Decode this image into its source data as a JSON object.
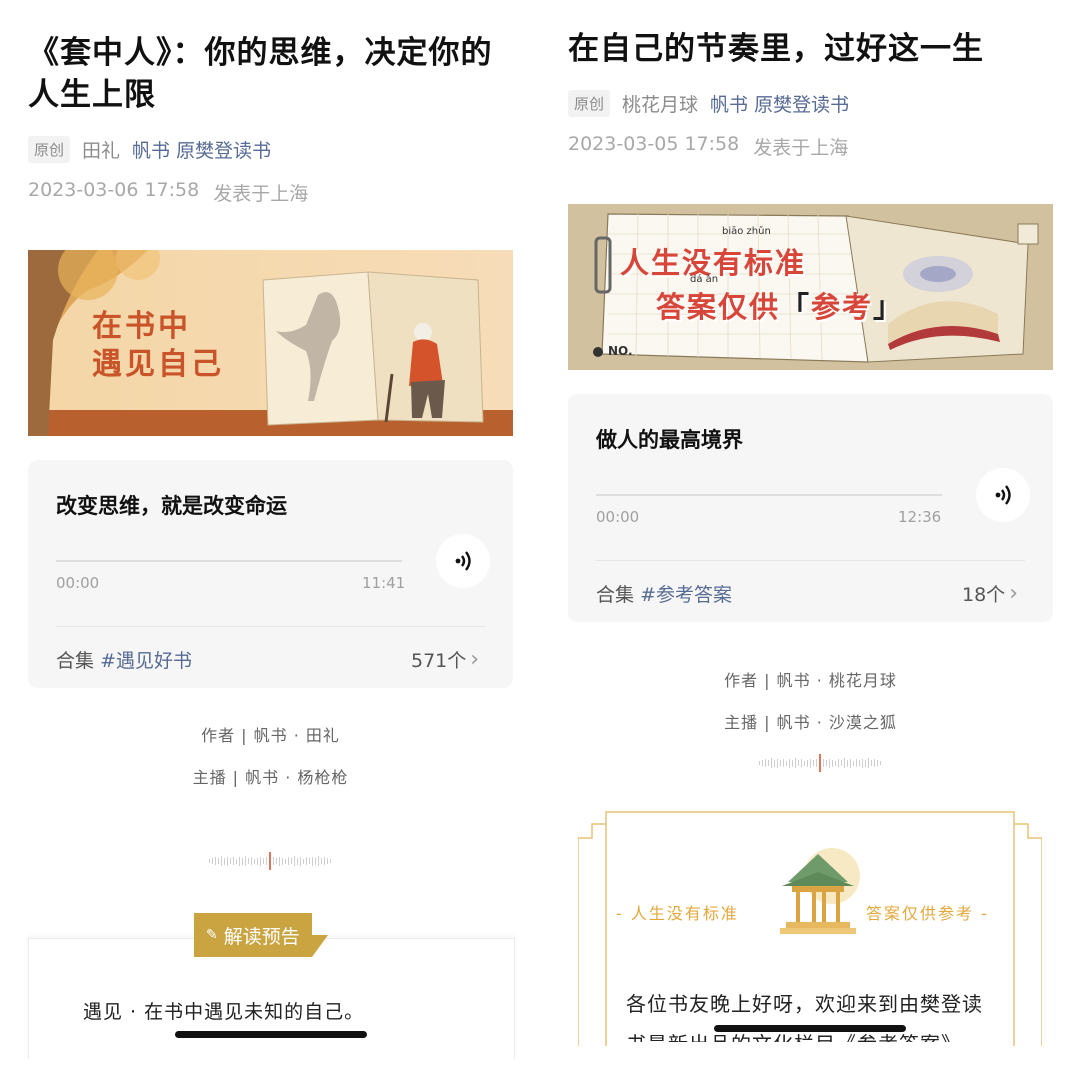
{
  "left": {
    "title": "《套中人》：你的思维，决定你的人生上限",
    "badge": "原创",
    "author": "田礼",
    "account": "帆书 原樊登读书",
    "date": "2023-03-06 17:58",
    "location": "发表于上海",
    "banner_text_line1": "在书中",
    "banner_text_line2": "遇见自己",
    "audio": {
      "title": "改变思维，就是改变命运",
      "current": "00:00",
      "duration": "11:41",
      "progress": 0
    },
    "collection": {
      "label": "合集",
      "tag": "#遇见好书",
      "count": "571个"
    },
    "credit_author": "作者 | 帆书 · 田礼",
    "credit_host": "主播 | 帆书 · 杨枪枪",
    "preview_tag": "解读预告",
    "body_text": "遇见 · 在书中遇见未知的自己。"
  },
  "right": {
    "title": "在自己的节奏里，过好这一生",
    "badge": "原创",
    "author": "桃花月球",
    "account": "帆书 原樊登读书",
    "date": "2023-03-05 17:58",
    "location": "发表于上海",
    "banner_line1": "人生没有标准",
    "banner_line2_a": "答案仅供",
    "banner_line2_b": "参考",
    "pinyin_biaozhun": "biāo zhǔn",
    "pinyin_daan": "dá àn",
    "banner_no": "NO.",
    "audio": {
      "title": "做人的最高境界",
      "current": "00:00",
      "duration": "12:36",
      "progress": 0
    },
    "collection": {
      "label": "合集",
      "tag": "#参考答案",
      "count": "18个"
    },
    "credit_author": "作者 | 帆书 · 桃花月球",
    "credit_host": "主播 | 帆书 · 沙漠之狐",
    "frame_left": "- 人生没有标准",
    "frame_right": "答案仅供参考 -",
    "body_text_1": "各位书友晚上好呀，欢迎来到由樊登读",
    "body_text_2": "书最新出品的文化栏目《参考答案》"
  },
  "colors": {
    "link": "#576b95",
    "gold": "#d4a53a",
    "accent_orange": "#c9542a"
  },
  "icons": {
    "play": "audio-wave-icon",
    "chevron": "chevron-right-icon",
    "pencil": "pencil-icon"
  }
}
